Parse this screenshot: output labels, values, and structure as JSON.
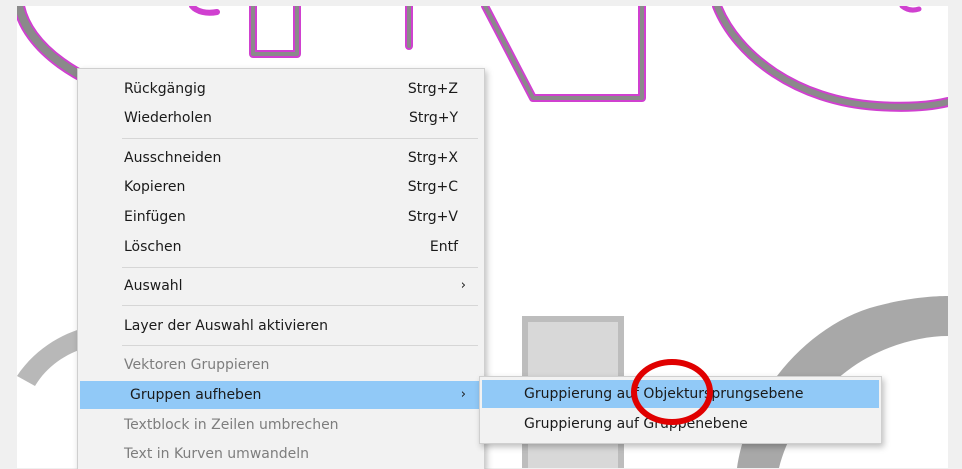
{
  "context_menu": {
    "items": [
      {
        "label": "Rückgängig",
        "shortcut": "Strg+Z"
      },
      {
        "label": "Wiederholen",
        "shortcut": "Strg+Y"
      },
      {
        "label": "Ausschneiden",
        "shortcut": "Strg+X"
      },
      {
        "label": "Kopieren",
        "shortcut": "Strg+C"
      },
      {
        "label": "Einfügen",
        "shortcut": "Strg+V"
      },
      {
        "label": "Löschen",
        "shortcut": "Entf"
      },
      {
        "label": "Auswahl",
        "submenu_arrow": "›"
      },
      {
        "label": "Layer der Auswahl aktivieren"
      },
      {
        "label": "Vektoren  Gruppieren",
        "disabled": true
      },
      {
        "label": "Gruppen aufheben",
        "submenu_arrow": "›",
        "highlighted": true
      },
      {
        "label": "Textblock in Zeilen umbrechen",
        "disabled": true
      },
      {
        "label": "Text in Kurven umwandeln",
        "disabled": true
      }
    ]
  },
  "submenu": {
    "items": [
      {
        "label": "Gruppierung auf Objektursprungsebene",
        "highlighted": true
      },
      {
        "label": "Gruppierung auf Gruppenebene"
      }
    ]
  },
  "colors": {
    "highlight": "#91c9f7",
    "annotation": "#e00000",
    "outline_magenta": "#d040d0",
    "shape_gray": "#8a8a8a"
  }
}
